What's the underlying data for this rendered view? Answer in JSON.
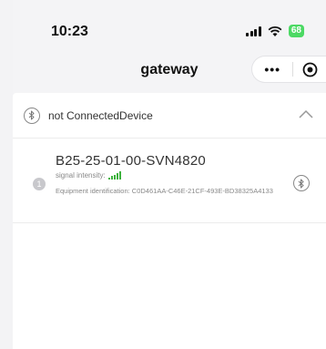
{
  "status_bar": {
    "time": "10:23",
    "battery": "68"
  },
  "nav": {
    "title": "gateway"
  },
  "section": {
    "title": "not ConnectedDevice"
  },
  "devices": [
    {
      "index": "1",
      "name": "B25-25-01-00-SVN4820",
      "signal_label": "signal intensity:",
      "signal_level": 5,
      "id_text": "Equipment identification: C0D461AA-C46E-21CF-493E-BD38325A4133"
    }
  ],
  "colors": {
    "signal_green": "#3db23d",
    "battery_green": "#4cd964"
  },
  "icons": [
    "signal-icon",
    "wifi-icon",
    "more-icon",
    "close-target-icon",
    "bluetooth-icon",
    "chevron-up-icon"
  ]
}
